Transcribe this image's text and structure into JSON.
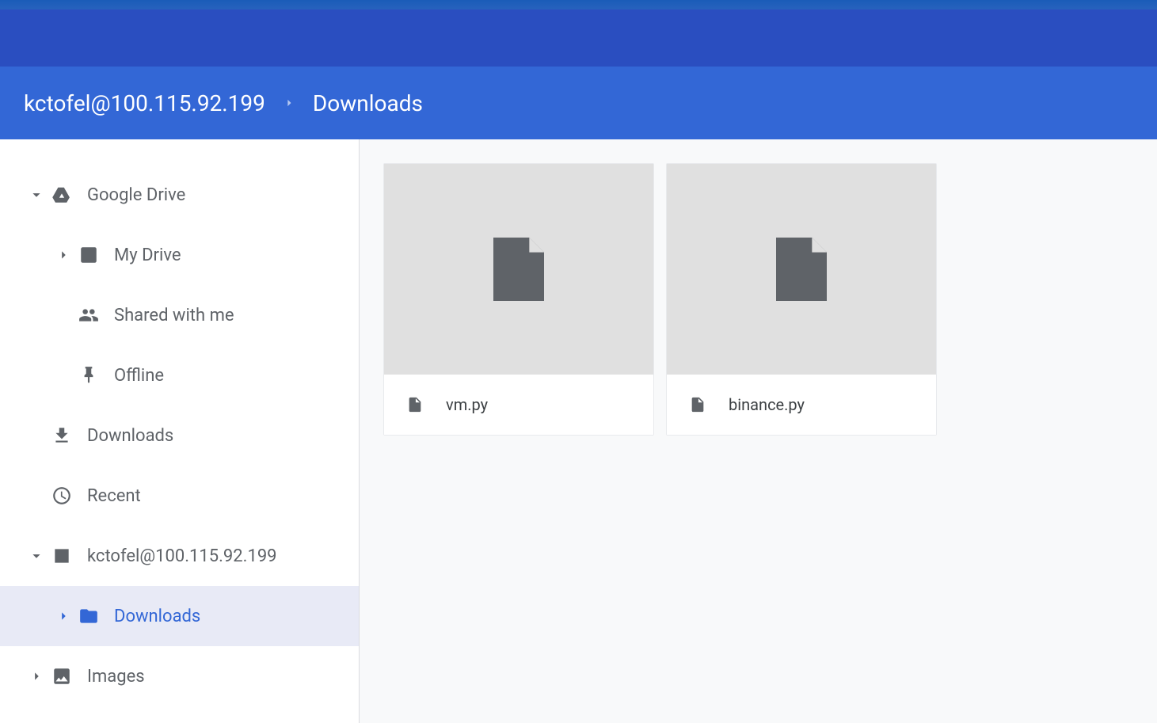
{
  "breadcrumb": {
    "root": "kctofel@100.115.92.199",
    "current": "Downloads"
  },
  "sidebar": {
    "google_drive": {
      "label": "Google Drive"
    },
    "my_drive": {
      "label": "My Drive"
    },
    "shared_with_me": {
      "label": "Shared with me"
    },
    "offline": {
      "label": "Offline"
    },
    "downloads": {
      "label": "Downloads"
    },
    "recent": {
      "label": "Recent"
    },
    "remote": {
      "label": "kctofel@100.115.92.199"
    },
    "remote_downloads": {
      "label": "Downloads"
    },
    "images": {
      "label": "Images"
    }
  },
  "files": [
    {
      "name": "vm.py"
    },
    {
      "name": "binance.py"
    }
  ]
}
